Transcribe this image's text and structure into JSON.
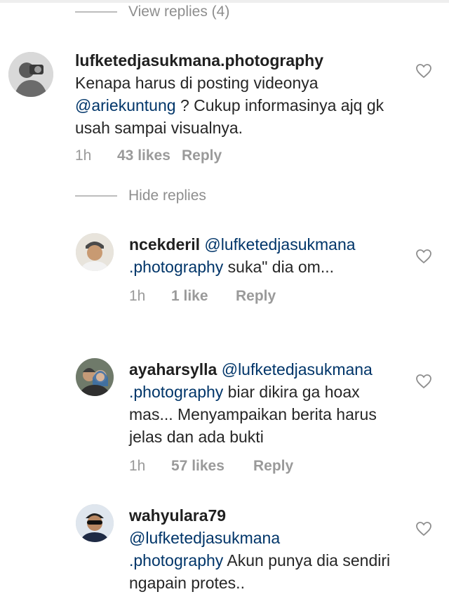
{
  "toggles": {
    "view_replies": "View replies (4)",
    "hide_replies": "Hide replies"
  },
  "comments": [
    {
      "username": "lufketedjasukmana.photography",
      "text_before": "Kenapa harus di posting videonya",
      "mention": "@ariekuntung",
      "text_after": " ? Cukup informasinya ajq gk usah sampai visualnya.",
      "time": "1h",
      "likes": "43 likes",
      "reply": "Reply",
      "avatar_icon": "photographer-avatar-icon"
    },
    {
      "username": "ncekderil",
      "mention_line1": "@lufketedjasukmana",
      "mention_line2": ".photography",
      "text": " suka\" dia om...",
      "time": "1h",
      "likes": "1 like",
      "reply": "Reply",
      "avatar_icon": "man-avatar-icon"
    },
    {
      "username": "ayaharsylla",
      "mention_line1": "@lufketedjasukmana",
      "mention_line2": ".photography",
      "text": " biar dikira ga hoax mas... Menyampaikan berita harus jelas dan ada bukti",
      "time": "1h",
      "likes": "57 likes",
      "reply": "Reply",
      "avatar_icon": "couple-avatar-icon"
    },
    {
      "username": "wahyulara79",
      "mention_line1": "@lufketedjasukmana",
      "mention_line2": ".photography",
      "text": " Akun punya dia sendiri ngapain protes..",
      "avatar_icon": "sunglasses-avatar-icon"
    }
  ],
  "colors": {
    "mention": "#003569",
    "meta": "#9a9a9a",
    "username": "#1f1f1f"
  }
}
